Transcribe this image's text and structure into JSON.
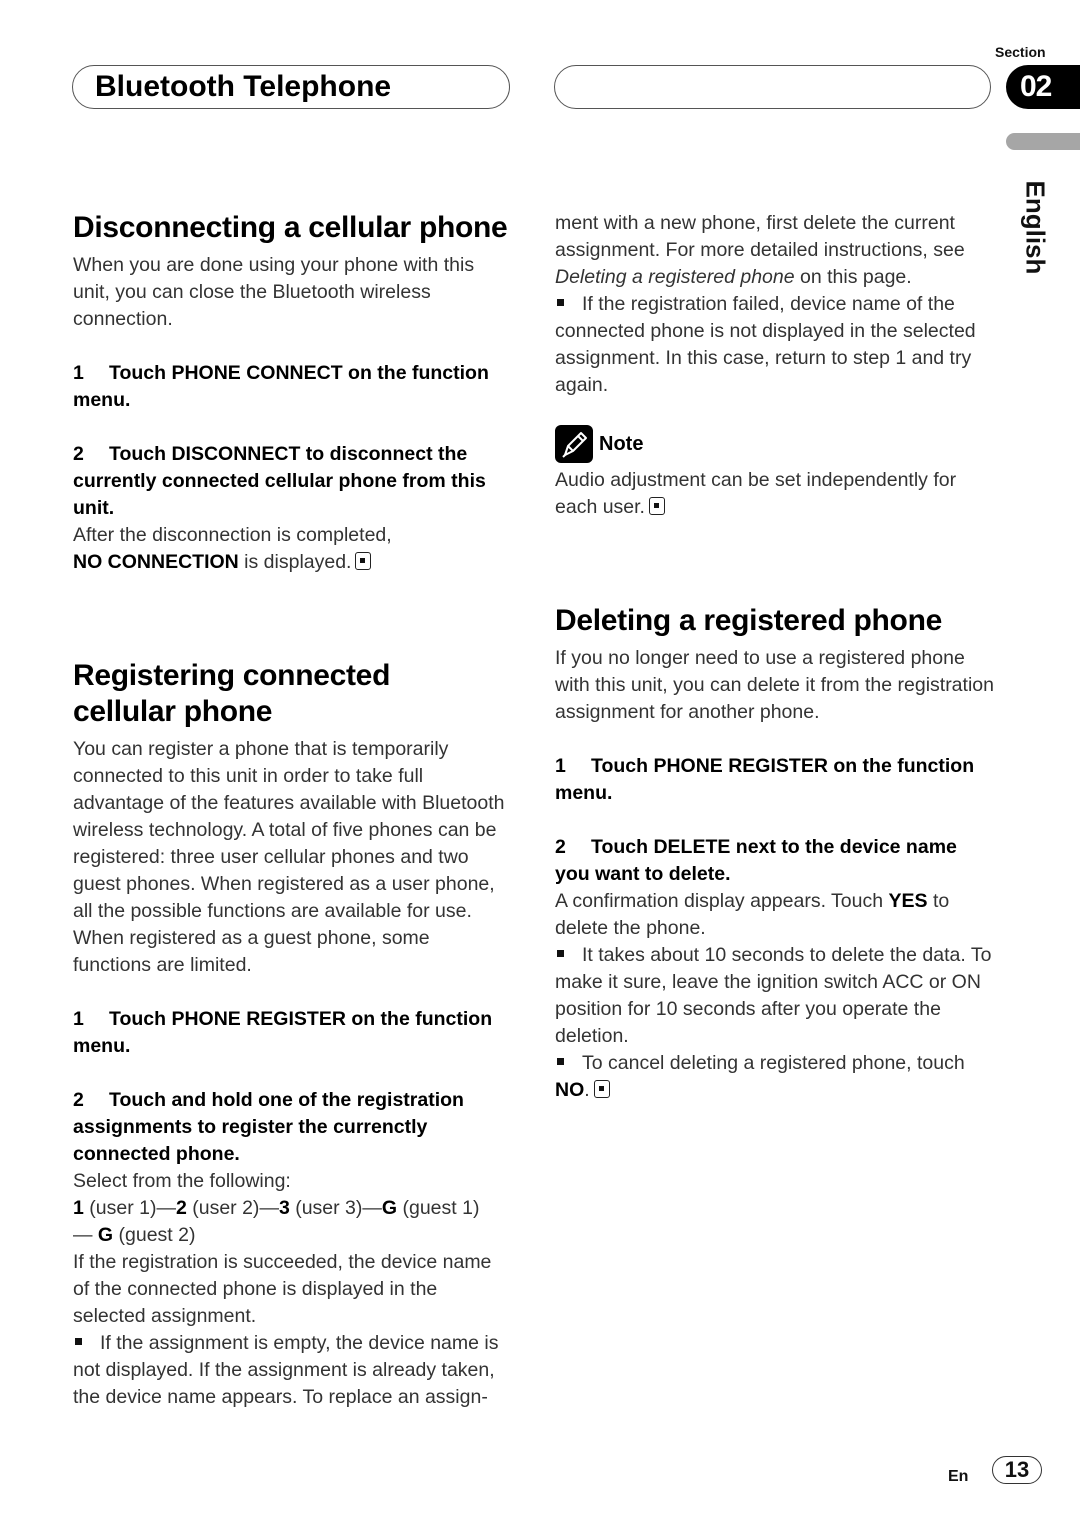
{
  "header": {
    "title": "Bluetooth Telephone",
    "section_label": "Section",
    "section_number": "02",
    "language": "English"
  },
  "left": {
    "disconnect": {
      "heading": "Disconnecting a cellular phone",
      "intro": "When you are done using your phone with this unit, you can close the Bluetooth wireless connection.",
      "step1_num": "1",
      "step1": "Touch PHONE CONNECT on the function menu.",
      "step2_num": "2",
      "step2": "Touch DISCONNECT to disconnect the currently connected cellular phone from this unit.",
      "result_pre": "After the disconnection is completed,",
      "result_bold": "NO CONNECTION",
      "result_post": " is displayed."
    },
    "register": {
      "heading_line1": "Registering connected",
      "heading_line2": "cellular phone",
      "intro": "You can register a phone that is temporarily connected to this unit in order to take full advantage of the features available with Bluetooth wireless technology. A total of five phones can be registered: three user cellular phones and two guest phones. When registered as a user phone, all the possible functions are available for use. When registered as a guest phone, some functions are limited.",
      "step1_num": "1",
      "step1": "Touch PHONE REGISTER on the function menu.",
      "step2_num": "2",
      "step2": "Touch and hold one of the registration assignments to register the currenctly connected phone.",
      "select_text": "Select from the following:",
      "options": [
        {
          "key": "1",
          "label": " (user 1)"
        },
        {
          "key": "2",
          "label": " (user 2)"
        },
        {
          "key": "3",
          "label": " (user 3)"
        },
        {
          "key": "G",
          "label": " (guest 1)"
        },
        {
          "key": "G",
          "label": " (guest 2)"
        }
      ],
      "separator": "—",
      "success_text": "If the registration is succeeded, the device name of the connected phone is displayed in the selected assignment.",
      "bullet1": "If the assignment is empty, the device name is not displayed. If the assignment is already taken, the device name appears. To replace an assign-"
    }
  },
  "right": {
    "continued_pre": "ment with a new phone, first delete the current assignment. For more detailed instructions, see ",
    "continued_italic": "Deleting a registered phone",
    "continued_post": " on this page.",
    "bullet2": "If the registration failed, device name of the connected phone is not displayed in the selected assignment. In this case, return to step 1 and try again.",
    "note": {
      "label": "Note",
      "text": "Audio adjustment can be set independently for each user."
    },
    "delete": {
      "heading": "Deleting a registered phone",
      "intro": "If you no longer need to use a registered phone with this unit, you can delete it from the registration assignment for another phone.",
      "step1_num": "1",
      "step1": "Touch PHONE REGISTER on the function menu.",
      "step2_num": "2",
      "step2": "Touch DELETE next to the device name you want to delete.",
      "confirm_pre": "A confirmation display appears. Touch ",
      "confirm_bold": "YES",
      "confirm_post": " to delete the phone.",
      "bullet1": "It takes about 10 seconds to delete the data. To make it sure, leave the ignition switch ACC or ON position for 10 seconds after you operate the deletion.",
      "bullet2_pre": "To cancel deleting a registered phone, touch",
      "bullet2_bold": "NO",
      "bullet2_post": "."
    }
  },
  "footer": {
    "lang_code": "En",
    "page_number": "13"
  }
}
